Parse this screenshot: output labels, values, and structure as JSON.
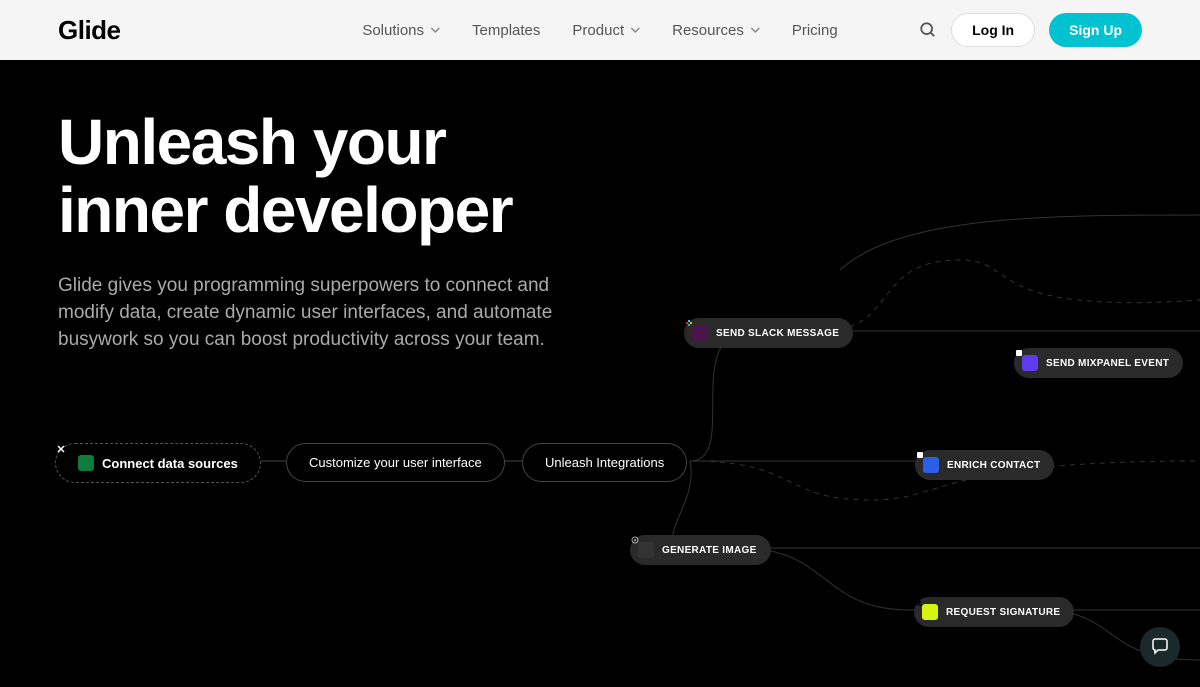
{
  "header": {
    "logo": "Glide",
    "nav": {
      "solutions": "Solutions",
      "templates": "Templates",
      "product": "Product",
      "resources": "Resources",
      "pricing": "Pricing"
    },
    "login": "Log In",
    "signup": "Sign Up"
  },
  "hero": {
    "title_line1": "Unleash your",
    "title_line2": "inner developer",
    "subtitle": "Glide gives you programming superpowers to connect and modify data, create dynamic user interfaces, and automate busywork so you can boost productivity across your team."
  },
  "flow": {
    "step1": "Connect data sources",
    "step2": "Customize your user interface",
    "step3": "Unleash Integrations"
  },
  "integrations": {
    "slack": "SEND SLACK MESSAGE",
    "mixpanel": "SEND MIXPANEL EVENT",
    "enrich": "ENRICH CONTACT",
    "generate": "GENERATE IMAGE",
    "signature": "REQUEST SIGNATURE"
  }
}
